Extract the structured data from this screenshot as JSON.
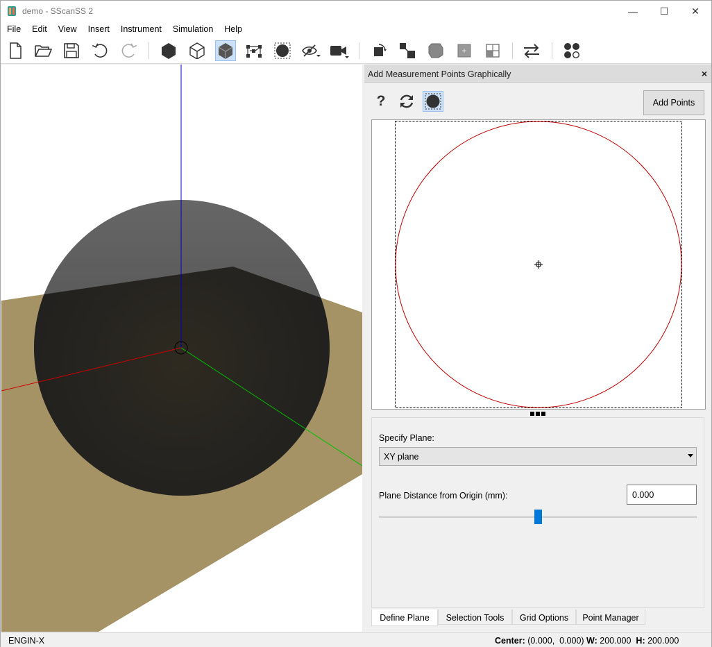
{
  "window": {
    "title": "demo - SScanSS 2",
    "controls": [
      "—",
      "☐",
      "✕"
    ]
  },
  "menu": [
    "File",
    "Edit",
    "View",
    "Insert",
    "Instrument",
    "Simulation",
    "Help"
  ],
  "toolbar": {
    "icons": [
      "new-file-icon",
      "open-folder-icon",
      "save-icon",
      "undo-icon",
      "redo-icon",
      "solid-render-icon",
      "wireframe-render-icon",
      "transparent-render-icon",
      "toggle-points-icon",
      "toggle-sample-icon",
      "toggle-visibility-icon",
      "camera-icon",
      "rotate-sample-icon",
      "translate-sample-icon",
      "transform-sample-icon",
      "plane-align-icon",
      "grid-icon",
      "swap-icon",
      "instrument-controls-icon"
    ]
  },
  "dock": {
    "title": "Add Measurement Points Graphically",
    "close": "×",
    "help_symbol": "?",
    "add_points_label": "Add Points"
  },
  "panel": {
    "specify_plane_label": "Specify Plane:",
    "plane_value": "XY plane",
    "distance_label": "Plane Distance from Origin (mm):",
    "distance_value": "0.000",
    "slider_fraction": 0.5
  },
  "tabs": [
    "Define Plane",
    "Selection Tools",
    "Grid Options",
    "Point Manager"
  ],
  "status": {
    "instrument": "ENGIN-X",
    "center_label": "Center:",
    "center_value": "(0.000,  0.000)",
    "w_label": "W:",
    "w_value": "200.000",
    "h_label": "H:",
    "h_value": "200.000"
  },
  "colors": {
    "accent": "#0078d7",
    "circle": "#c00000",
    "plate": "#a59366",
    "sphere": "#3a3a3a",
    "x_axis": "#d00000",
    "y_axis": "#00c000",
    "z_axis": "#0000c0"
  }
}
